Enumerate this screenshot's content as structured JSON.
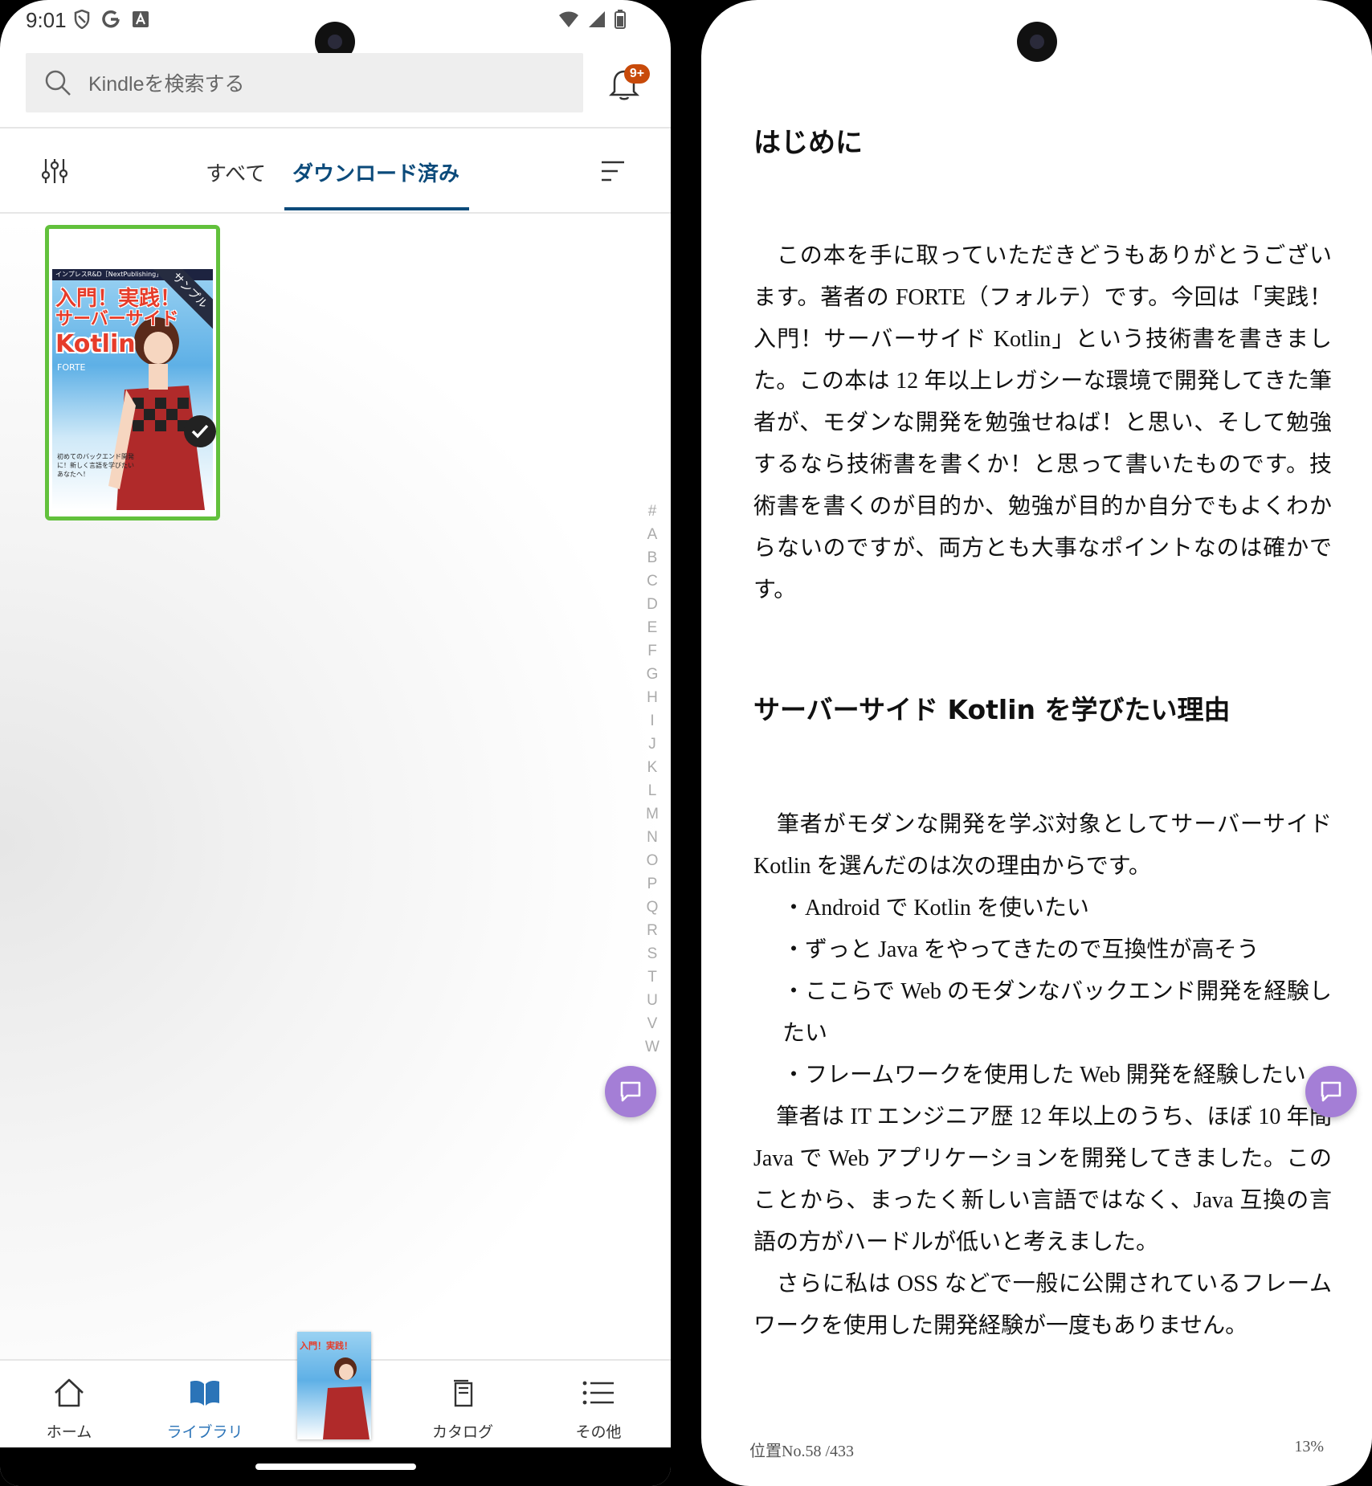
{
  "status_bar": {
    "time": "9:01"
  },
  "search": {
    "placeholder": "Kindleを検索する"
  },
  "notifications": {
    "badge": "9+"
  },
  "tabs": [
    {
      "label": "すべて"
    },
    {
      "label": "ダウンロード済み"
    }
  ],
  "library": {
    "book": {
      "cover_top_text": "インプレスR&D［NextPublishing］",
      "cover_title_line1": "入門！実践！",
      "cover_title_line2": "サーバーサイド",
      "cover_title_line3": "Kotlin",
      "cover_author": "FORTE",
      "cover_subtitle": "初めてのバックエンド開発に！新しく言語を学びたいあなたへ！",
      "sample_label": "サンプル",
      "downloaded": true
    },
    "az_index": [
      "#",
      "A",
      "B",
      "C",
      "D",
      "E",
      "F",
      "G",
      "H",
      "I",
      "J",
      "K",
      "L",
      "M",
      "N",
      "O",
      "P",
      "Q",
      "R",
      "S",
      "T",
      "U",
      "V",
      "W"
    ]
  },
  "bottom_nav": [
    {
      "label": "ホーム",
      "icon": "home-icon"
    },
    {
      "label": "ライブラリ",
      "icon": "library-icon"
    },
    {
      "label": "カタログ",
      "icon": "catalog-icon"
    },
    {
      "label": "その他",
      "icon": "more-icon"
    }
  ],
  "reader": {
    "heading1": "はじめに",
    "para1": "　この本を手に取っていただきどうもありがとうございます。著者の FORTE（フォルテ）です。今回は「実践！入門！サーバーサイド Kotlin」という技術書を書きました。この本は 12 年以上レガシーな環境で開発してきた筆者が、モダンな開発を勉強せねば！と思い、そして勉強するなら技術書を書くか！と思って書いたものです。技術書を書くのが目的か、勉強が目的か自分でもよくわからないのですが、両方とも大事なポイントなのは確かです。",
    "heading2": "サーバーサイド Kotlin を学びたい理由",
    "para2": "　筆者がモダンな開発を学ぶ対象としてサーバーサイド Kotlin を選んだのは次の理由からです。",
    "bullets": [
      "・Android で Kotlin を使いたい",
      "・ずっと Java をやってきたので互換性が高そう",
      "・ここらで Web のモダンなバックエンド開発を経験したい",
      "・フレームワークを使用した Web 開発を経験したい"
    ],
    "para3": "　筆者は IT エンジニア歴 12 年以上のうち、ほぼ 10 年間 Java で Web アプリケーションを開発してきました。このことから、まったく新しい言語ではなく、Java 互換の言語の方がハードルが低いと考えました。",
    "para4": "　さらに私は OSS などで一般に公開されているフレームワークを使用した開発経験が一度もありません。",
    "location": "位置No.58 /433",
    "progress": "13%"
  },
  "colors": {
    "accent": "#0b4a7a",
    "tile_border": "#62c13c",
    "fab": "#a47ed6",
    "badge": "#c84a0a",
    "nav_active": "#2b74b8"
  }
}
